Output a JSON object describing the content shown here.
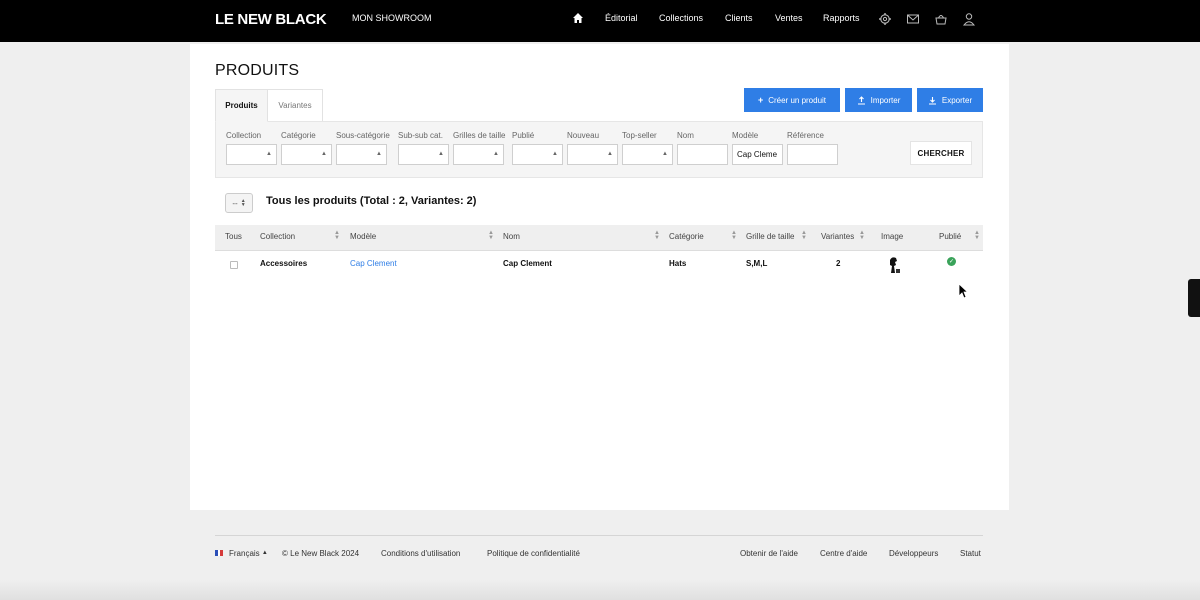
{
  "topbar": {
    "logo": "LE NEW BLACK",
    "showroom": "MON SHOWROOM",
    "nav": [
      "Éditorial",
      "Collections",
      "Clients",
      "Ventes",
      "Rapports"
    ],
    "icons": [
      "home-icon",
      "gear-icon",
      "mail-icon",
      "basket-icon",
      "user-icon"
    ]
  },
  "page": {
    "title": "PRODUITS",
    "tabs": [
      "Produits",
      "Variantes"
    ],
    "actions": {
      "create": "Créer un produit",
      "import": "Importer",
      "export": "Exporter"
    },
    "accent": "#2f7ee6"
  },
  "filters": {
    "labels": [
      "Collection",
      "Catégorie",
      "Sous-catégorie",
      "Sub-sub cat.",
      "Grilles de taille",
      "Publié",
      "Nouveau",
      "Top-seller",
      "Nom",
      "Modèle",
      "Référence"
    ],
    "modele_value": "Cap Cleme",
    "nom_value": "",
    "reference_value": "",
    "search_label": "CHERCHER"
  },
  "list": {
    "page_size": "--",
    "summary": "Tous les produits (Total : 2, Variantes: 2)",
    "columns": [
      "Tous",
      "Collection",
      "Modèle",
      "Nom",
      "Catégorie",
      "Grille de taille",
      "Variantes",
      "Image",
      "Publié"
    ],
    "rows": [
      {
        "collection": "Accessoires",
        "modele": "Cap Clement",
        "nom": "Cap Clement",
        "categorie": "Hats",
        "grille": "S,M,L",
        "variantes": "2",
        "published": true
      }
    ]
  },
  "footer": {
    "language": "Français",
    "copyright": "© Le New Black 2024",
    "links_left": [
      "Conditions d'utilisation",
      "Politique de confidentialité"
    ],
    "links_right": [
      "Obtenir de l'aide",
      "Centre d'aide",
      "Développeurs",
      "Statut"
    ]
  },
  "status_colors": {
    "published": "#3aa35a"
  }
}
